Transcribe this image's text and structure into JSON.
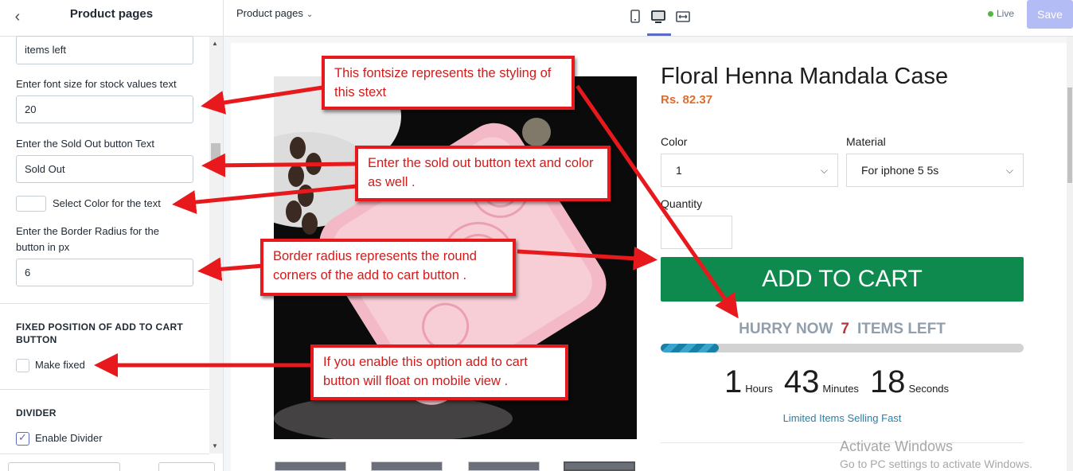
{
  "sidebar": {
    "title": "Product pages",
    "field_items_left": "items left",
    "font_size_label": "Enter font size for stock values text",
    "font_size_value": "20",
    "sold_out_label": "Enter the Sold Out button Text",
    "sold_out_value": "Sold Out",
    "color_label": "Select Color for the text",
    "border_radius_label": "Enter the Border Radius for the button in px",
    "border_radius_value": "6",
    "fixed_section_heading": "FIXED POSITION OF ADD TO CART BUTTON",
    "make_fixed_label": "Make fixed",
    "make_fixed_checked": false,
    "divider_heading": "DIVIDER",
    "enable_divider_label": "Enable Divider",
    "enable_divider_checked": true
  },
  "topbar": {
    "page_select": "Product pages",
    "live_label": "Live",
    "save_label": "Save"
  },
  "product": {
    "title": "Floral Henna Mandala Case",
    "price": "Rs. 82.37",
    "color_label": "Color",
    "color_value": "1",
    "material_label": "Material",
    "material_value": "For iphone 5 5s",
    "quantity_label": "Quantity",
    "add_to_cart": "ADD TO CART",
    "hurry_prefix": "HURRY NOW",
    "hurry_count": "7",
    "hurry_suffix": "ITEMS LEFT",
    "stock_fraction": 0.16,
    "timer_hours": "1",
    "timer_hours_label": "Hours",
    "timer_minutes": "43",
    "timer_minutes_label": "Minutes",
    "timer_seconds": "18",
    "timer_seconds_label": "Seconds",
    "selling_fast": "Limited Items Selling Fast"
  },
  "watermark": {
    "line1": "Activate Windows",
    "line2": "Go to PC settings to activate Windows."
  },
  "callouts": {
    "fontsize": "This fontsize represents the styling of this stext",
    "sold_out": "Enter the sold out button text and color as well .",
    "border_radius": "Border radius represents the round corners of the add to cart button .",
    "fixed": "If you  enable this option add to cart button will float on mobile view ."
  },
  "colors": {
    "add_to_cart_bg": "#0e8a4f",
    "price": "#e06c2b",
    "callout_border": "#e8191c",
    "save_btn": "#b3bcf5"
  }
}
